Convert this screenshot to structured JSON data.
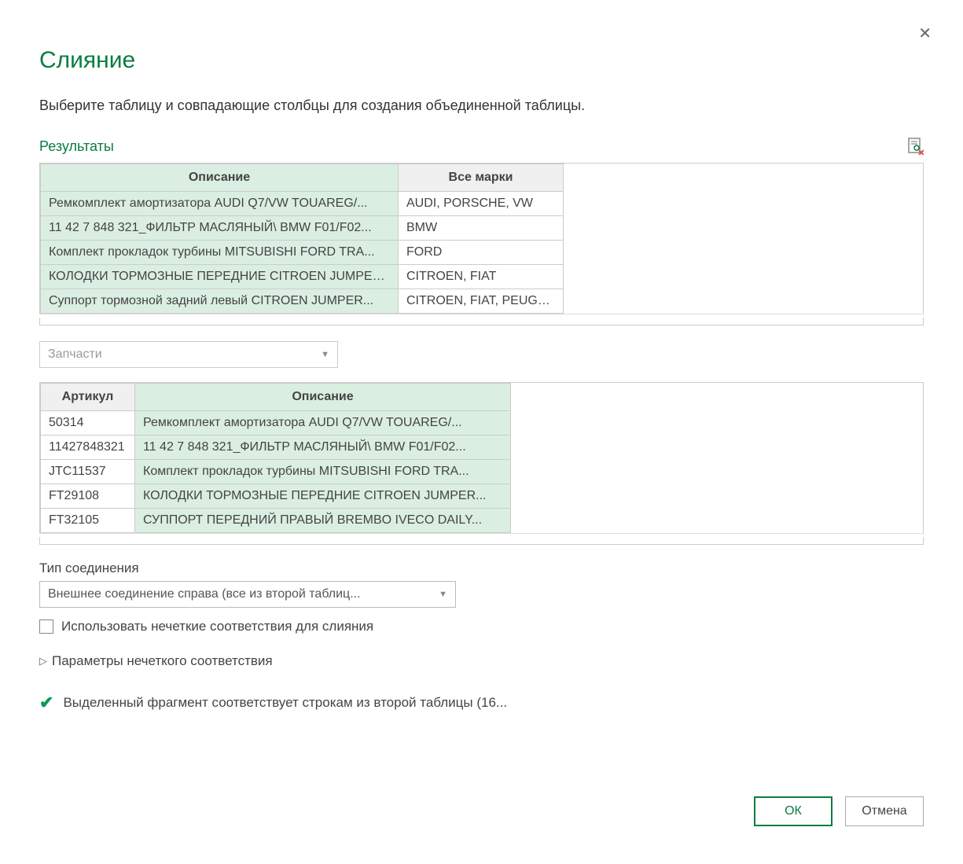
{
  "dialog": {
    "title": "Слияние",
    "subtitle": "Выберите таблицу и совпадающие столбцы для создания объединенной таблицы."
  },
  "section": {
    "results_label": "Результаты"
  },
  "table1": {
    "headers": {
      "c1": "Описание",
      "c2": "Все марки"
    },
    "rows": [
      {
        "c1": "Ремкомплект амортизатора AUDI Q7/VW TOUAREG/...",
        "c2": "AUDI, PORSCHE, VW"
      },
      {
        "c1": "11 42 7 848 321_ФИЛЬТР МАСЛЯНЫЙ\\ BMW F01/F02...",
        "c2": "BMW"
      },
      {
        "c1": "Комплект прокладок турбины MITSUBISHI FORD TRA...",
        "c2": "FORD"
      },
      {
        "c1": "КОЛОДКИ ТОРМОЗНЫЕ ПЕРЕДНИЕ CITROEN JUMPER...",
        "c2": "CITROEN, FIAT"
      },
      {
        "c1": "Суппорт тормозной задний левый CITROEN JUMPER...",
        "c2": "CITROEN, FIAT, PEUGEOT"
      }
    ]
  },
  "second_table_dropdown": {
    "value": "Запчасти"
  },
  "table2": {
    "headers": {
      "c1": "Артикул",
      "c2": "Описание"
    },
    "rows": [
      {
        "c1": "50314",
        "c2": "Ремкомплект амортизатора AUDI Q7/VW TOUAREG/..."
      },
      {
        "c1": "11427848321",
        "c2": "11 42 7 848 321_ФИЛЬТР МАСЛЯНЫЙ\\ BMW F01/F02..."
      },
      {
        "c1": "JTC11537",
        "c2": "Комплект прокладок турбины MITSUBISHI FORD TRA..."
      },
      {
        "c1": "FT29108",
        "c2": "КОЛОДКИ ТОРМОЗНЫЕ ПЕРЕДНИЕ CITROEN JUMPER..."
      },
      {
        "c1": "FT32105",
        "c2": "СУППОРТ ПЕРЕДНИЙ ПРАВЫЙ BREMBO IVECO DAILY..."
      }
    ]
  },
  "join": {
    "label": "Тип соединения",
    "value": "Внешнее соединение справа (все из второй таблиц..."
  },
  "fuzzy": {
    "checkbox_label": "Использовать нечеткие соответствия для слияния",
    "params_label": "Параметры нечеткого соответствия"
  },
  "status": {
    "text": "Выделенный фрагмент соответствует строкам из второй таблицы (16..."
  },
  "buttons": {
    "ok": "ОК",
    "cancel": "Отмена"
  }
}
